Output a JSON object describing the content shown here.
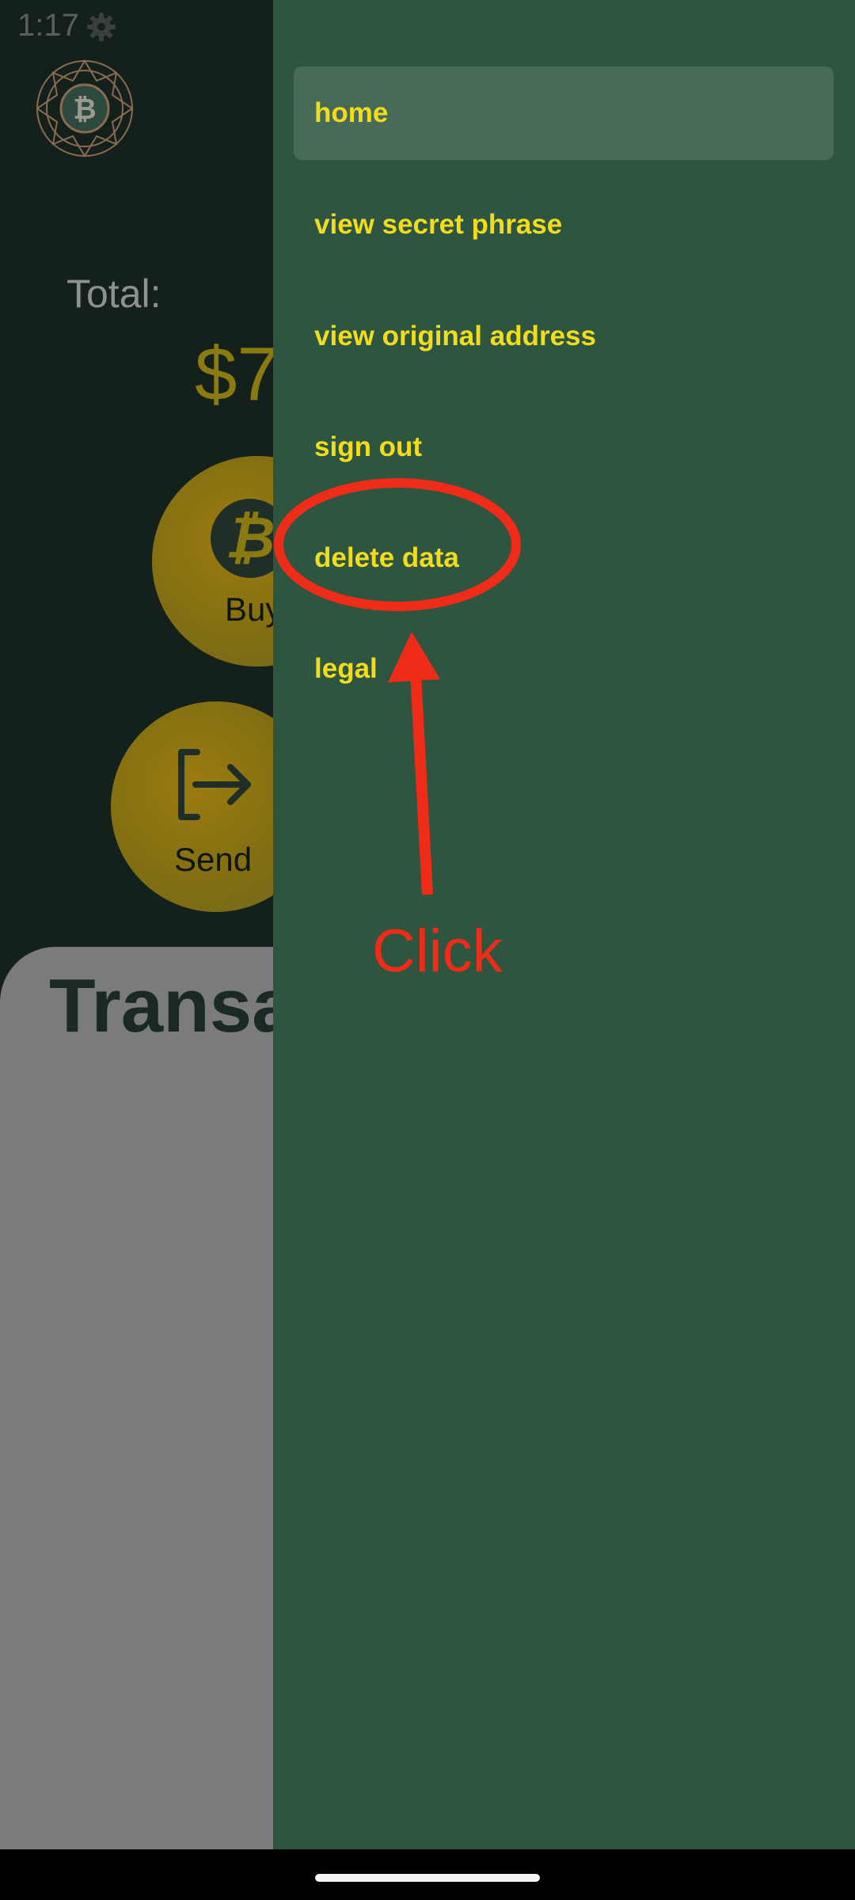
{
  "status_bar": {
    "time": "1:17"
  },
  "app": {
    "total_label": "Total:",
    "total_value": "$7",
    "buy_label": "Buy",
    "buy_icon_glyph": "₿",
    "send_label": "Send",
    "transactions_title": "Transa"
  },
  "drawer": {
    "items": [
      {
        "label": "home",
        "active": true
      },
      {
        "label": "view secret phrase",
        "active": false
      },
      {
        "label": "view original address",
        "active": false
      },
      {
        "label": "sign out",
        "active": false
      },
      {
        "label": "delete data",
        "active": false
      },
      {
        "label": "legal",
        "active": false
      }
    ]
  },
  "annotation": {
    "text": "Click",
    "color": "#ef2c17"
  },
  "colors": {
    "drawer_bg": "#2e5540",
    "menu_text": "#f1dc1f",
    "active_item_bg": "#486b58",
    "app_bg": "#14201c",
    "card_bg": "#7b7b7e"
  },
  "icons": {
    "logo": "bitcoin-mandala-logo",
    "gear": "gear-icon",
    "wifi": "wifi-icon",
    "signal": "signal-icon",
    "battery": "battery-icon",
    "buy": "bitcoin-icon",
    "send": "send-exit-icon"
  }
}
